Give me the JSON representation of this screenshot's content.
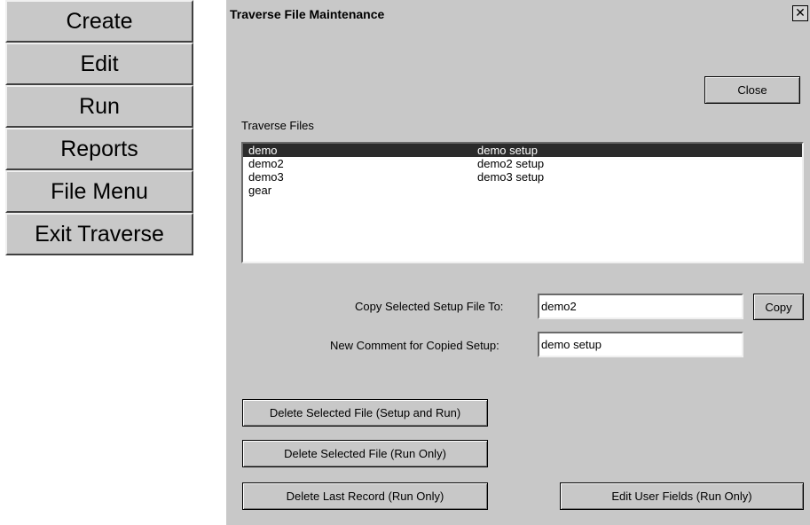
{
  "menu": {
    "items": [
      {
        "label": "Create"
      },
      {
        "label": "Edit"
      },
      {
        "label": "Run"
      },
      {
        "label": "Reports"
      },
      {
        "label": "File Menu"
      },
      {
        "label": "Exit Traverse"
      }
    ]
  },
  "dialog": {
    "title": "Traverse File Maintenance",
    "close_x": "✕",
    "close_button": "Close",
    "list_label": "Traverse Files",
    "files": [
      {
        "name": "demo",
        "comment": "demo setup",
        "selected": true
      },
      {
        "name": "demo2",
        "comment": "demo2 setup",
        "selected": false
      },
      {
        "name": "demo3",
        "comment": "demo3 setup",
        "selected": false
      },
      {
        "name": "gear",
        "comment": "",
        "selected": false
      }
    ],
    "copy_label": "Copy Selected Setup File To:",
    "copy_value": "demo2",
    "copy_button": "Copy",
    "comment_label": "New Comment for Copied Setup:",
    "comment_value": "demo setup",
    "delete_setup_run": "Delete Selected File (Setup and Run)",
    "delete_run_only": "Delete Selected File (Run Only)",
    "delete_last_record": "Delete Last Record (Run Only)",
    "edit_user_fields": "Edit User Fields (Run Only)"
  }
}
